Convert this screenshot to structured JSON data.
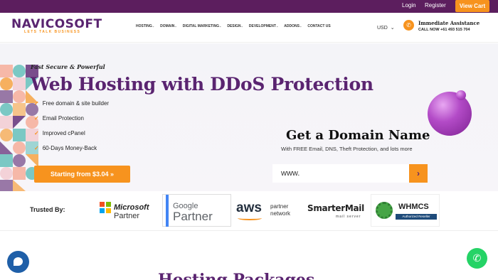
{
  "topbar": {
    "login": "Login",
    "register": "Register",
    "cart": "View Cart"
  },
  "header": {
    "logo": "NAVICOSOFT",
    "tagline": "LETS TALK BUSINESS",
    "nav": [
      {
        "label": "HOSTING",
        "has_dropdown": true
      },
      {
        "label": "DOMAIN",
        "has_dropdown": true
      },
      {
        "label": "DIGITAL MARKETING",
        "has_dropdown": true
      },
      {
        "label": "DESIGN",
        "has_dropdown": true
      },
      {
        "label": "DEVELOPMENT",
        "has_dropdown": true
      },
      {
        "label": "ADDONS",
        "has_dropdown": true
      },
      {
        "label": "CONTACT US",
        "has_dropdown": false
      }
    ],
    "currency": "USD",
    "assistance_title": "Immediate Assistance",
    "call_now": "CALL NOW +61 493 515 704"
  },
  "hero": {
    "kicker": "Fast Secure & Powerful",
    "headline": "Web Hosting with DDoS Protection",
    "features": [
      "Free domain & site builder",
      "Email Protection",
      "Improved cPanel",
      "60-Days Money-Back"
    ],
    "cta": "Starting from $3.04 »",
    "domain_title": "Get a Domain Name",
    "domain_subtitle": "With FREE Email, DNS, Theft Protection, and lots more",
    "domain_input_value": "www.",
    "domain_button": "›"
  },
  "trusted": {
    "label": "Trusted By:",
    "partners": {
      "microsoft_1": "Microsoft",
      "microsoft_2": "Partner",
      "google_1": "Google",
      "google_2": "Partner",
      "aws_1": "aws",
      "aws_2": "partner",
      "aws_3": "network",
      "smartermail_1": "SmarterMail",
      "smartermail_2": "mail server",
      "whmcs_1": "WHMCS",
      "whmcs_2": "Authorized Reseller"
    }
  },
  "next_section": {
    "heading": "Hosting Packages"
  },
  "colors": {
    "brand_purple": "#5a2470",
    "topbar": "#5c1e5e",
    "accent_orange": "#f7931e",
    "chat_blue": "#1f5fa8",
    "whatsapp_green": "#25d366"
  },
  "icons": [
    "phone-icon",
    "chevron-down-icon",
    "check-icon",
    "arrow-right-icon",
    "chat-icon",
    "whatsapp-icon"
  ]
}
